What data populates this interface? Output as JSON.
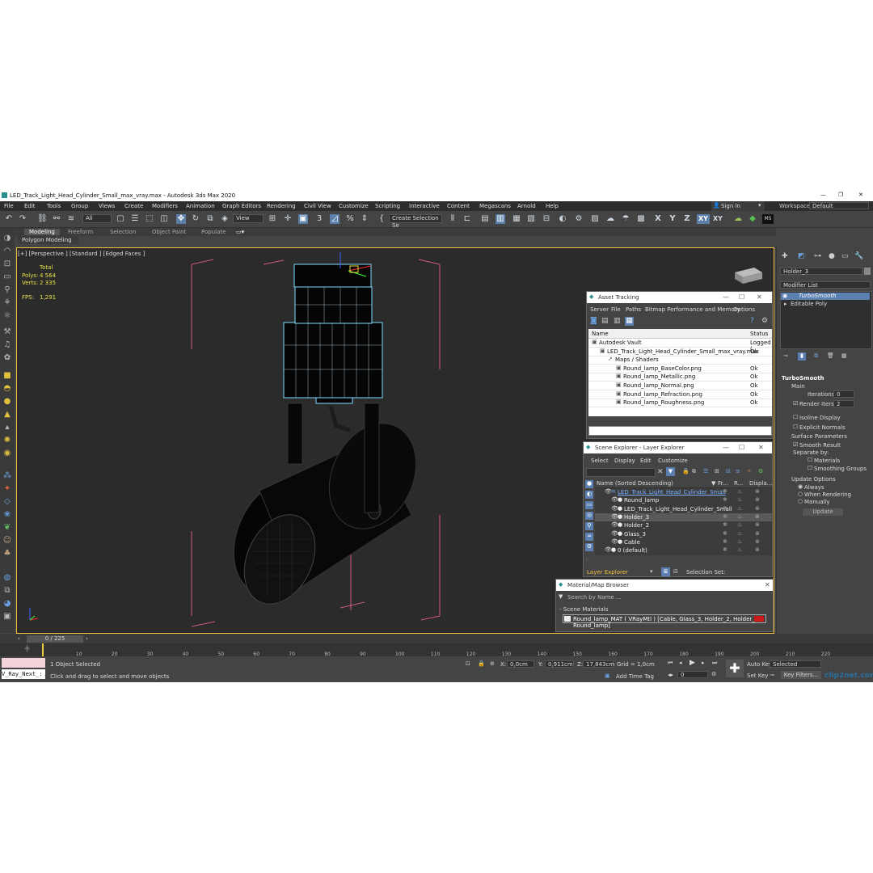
{
  "window": {
    "title": "LED_Track_Light_Head_Cylinder_Small_max_vray.max - Autodesk 3ds Max 2020",
    "controls": [
      "—",
      "❐",
      "✕"
    ]
  },
  "menu": [
    "File",
    "Edit",
    "Tools",
    "Group",
    "Views",
    "Create",
    "Modifiers",
    "Animation",
    "Graph Editors",
    "Rendering",
    "Civil View",
    "Customize",
    "Scripting",
    "Interactive",
    "Content",
    "Megascans",
    "Arnold",
    "Help"
  ],
  "account": {
    "sign_in": "Sign In",
    "workspaces_label": "Workspaces:",
    "workspace_value": "Default"
  },
  "toolbar": {
    "filter_value": "All",
    "view_value": "View",
    "selection_set": "Create Selection Se",
    "axes": [
      "X",
      "Y",
      "Z",
      "XY",
      "XY"
    ]
  },
  "ribbon": {
    "tabs": [
      "Modeling",
      "Freeform",
      "Selection",
      "Object Paint",
      "Populate"
    ],
    "sub": "Polygon Modeling"
  },
  "viewport": {
    "label": "[+] [Perspective ] [Standard ] [Edged Faces ]",
    "stats": {
      "total_label": "Total",
      "polys_label": "Polys:",
      "polys": "4 564",
      "verts_label": "Verts:",
      "verts": "2 335",
      "fps_label": "FPS:",
      "fps": "1,291"
    }
  },
  "command_panel": {
    "object_name": "Holder_3",
    "modifier_list": "Modifier List",
    "stack": [
      "TurboSmooth",
      "Editable Poly"
    ],
    "rollout_title": "TurboSmooth",
    "main": "Main",
    "iterations_label": "Iterations:",
    "iterations": "0",
    "render_iters_label": "Render Iters:",
    "render_iters": "2",
    "isoline": "Isoline Display",
    "explicit_normals": "Explicit Normals",
    "surface_params": "Surface Parameters",
    "smooth_result": "Smooth Result",
    "separate_by": "Separate by:",
    "materials": "Materials",
    "smoothing_groups": "Smoothing Groups",
    "update_options": "Update Options",
    "always": "Always",
    "when_rendering": "When Rendering",
    "manually": "Manually",
    "update_button": "Update"
  },
  "asset_tracking": {
    "title": "Asset Tracking",
    "menu": [
      "Server",
      "File",
      "Paths",
      "Bitmap Performance and Memory",
      "Options"
    ],
    "col_name": "Name",
    "col_status": "Status",
    "rows": [
      {
        "name": "Autodesk Vault",
        "status": "Logged (",
        "indent": 0
      },
      {
        "name": "LED_Track_Light_Head_Cylinder_Small_max_vray.max",
        "status": "Ok",
        "indent": 1
      },
      {
        "name": "Maps / Shaders",
        "status": "",
        "indent": 2
      },
      {
        "name": "Round_lamp_BaseColor.png",
        "status": "Ok",
        "indent": 3
      },
      {
        "name": "Round_lamp_Metallic.png",
        "status": "Ok",
        "indent": 3
      },
      {
        "name": "Round_lamp_Normal.png",
        "status": "Ok",
        "indent": 3
      },
      {
        "name": "Round_lamp_Refraction.png",
        "status": "Ok",
        "indent": 3
      },
      {
        "name": "Round_lamp_Roughness.png",
        "status": "Ok",
        "indent": 3
      }
    ]
  },
  "scene_explorer": {
    "title": "Scene Explorer - Layer Explorer",
    "menu": [
      "Select",
      "Display",
      "Edit",
      "Customize"
    ],
    "col_name": "Name (Sorted Descending)",
    "col_fr": "Fr...",
    "col_r": "R...",
    "col_disp": "Displa...",
    "rows": [
      {
        "name": "LED_Track_Light_Head_Cylinder_Small",
        "indent": 1,
        "sel": false,
        "layer": true
      },
      {
        "name": "Round_lamp",
        "indent": 2,
        "sel": false
      },
      {
        "name": "LED_Track_Light_Head_Cylinder_Small",
        "indent": 2,
        "sel": false
      },
      {
        "name": "Holder_3",
        "indent": 2,
        "sel": true
      },
      {
        "name": "Holder_2",
        "indent": 2,
        "sel": false
      },
      {
        "name": "Glass_3",
        "indent": 2,
        "sel": false
      },
      {
        "name": "Cable",
        "indent": 2,
        "sel": false
      },
      {
        "name": "0 (default)",
        "indent": 1,
        "sel": false
      }
    ],
    "footer_layer": "Layer Explorer",
    "footer_selset": "Selection Set:"
  },
  "material_browser": {
    "title": "Material/Map Browser",
    "search": "Search by Name ...",
    "section": "- Scene Materials",
    "item": "Round_lamp_MAT  ( VRayMtl ) [Cable, Glass_3, Holder_2, Holder_3, Round_lamp]"
  },
  "timeline": {
    "frame": "0 / 225",
    "ticks": [
      "0",
      "10",
      "20",
      "30",
      "40",
      "50",
      "60",
      "70",
      "80",
      "90",
      "100",
      "110",
      "120",
      "130",
      "140",
      "150",
      "160",
      "170",
      "180",
      "190",
      "200",
      "210",
      "220"
    ]
  },
  "status": {
    "script": "V_Ray_Next_:",
    "selected": "1 Object Selected",
    "hint": "Click and drag to select and move objects",
    "x_label": "X:",
    "x": "0,0cm",
    "y_label": "Y:",
    "y": "0,911cm",
    "z_label": "Z:",
    "z": "17,843cm",
    "grid": "Grid = 1,0cm",
    "add_time_tag": "Add Time Tag",
    "auto_key": "Auto Key",
    "set_key": "Set Key",
    "selected_dd": "Selected",
    "key_filters": "Key Filters...",
    "frame_field": "0"
  },
  "watermark": "clip2net.com"
}
